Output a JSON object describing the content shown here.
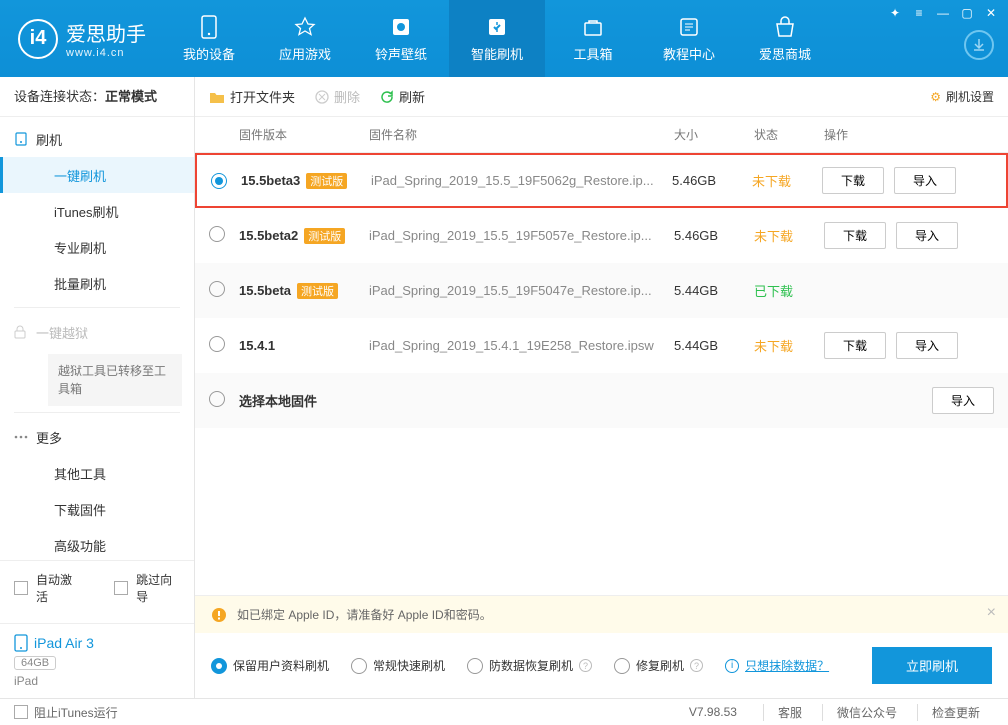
{
  "logo": {
    "title": "爱思助手",
    "sub": "www.i4.cn"
  },
  "nav": [
    {
      "label": "我的设备"
    },
    {
      "label": "应用游戏"
    },
    {
      "label": "铃声壁纸"
    },
    {
      "label": "智能刷机"
    },
    {
      "label": "工具箱"
    },
    {
      "label": "教程中心"
    },
    {
      "label": "爱思商城"
    }
  ],
  "sidebar": {
    "status_label": "设备连接状态：",
    "status_value": "正常模式",
    "items": {
      "flash": "刷机",
      "one_key": "一键刷机",
      "itunes": "iTunes刷机",
      "pro": "专业刷机",
      "batch": "批量刷机",
      "jailbreak": "一键越狱",
      "jb_note": "越狱工具已转移至工具箱",
      "more": "更多",
      "other": "其他工具",
      "download": "下载固件",
      "advanced": "高级功能"
    },
    "bottom": {
      "auto_activate": "自动激活",
      "skip_guide": "跳过向导"
    },
    "device": {
      "name": "iPad Air 3",
      "capacity": "64GB",
      "type": "iPad"
    }
  },
  "toolbar": {
    "open": "打开文件夹",
    "delete": "删除",
    "refresh": "刷新",
    "settings": "刷机设置"
  },
  "table": {
    "headers": {
      "version": "固件版本",
      "name": "固件名称",
      "size": "大小",
      "status": "状态",
      "ops": "操作"
    },
    "download_btn": "下载",
    "import_btn": "导入",
    "rows": [
      {
        "selected": true,
        "version": "15.5beta3",
        "beta": true,
        "name": "iPad_Spring_2019_15.5_19F5062g_Restore.ip...",
        "size": "5.46GB",
        "status": "未下载",
        "status_cls": "not",
        "show_dl": true,
        "hl": true
      },
      {
        "selected": false,
        "version": "15.5beta2",
        "beta": true,
        "name": "iPad_Spring_2019_15.5_19F5057e_Restore.ip...",
        "size": "5.46GB",
        "status": "未下载",
        "status_cls": "not",
        "show_dl": true
      },
      {
        "selected": false,
        "version": "15.5beta",
        "beta": true,
        "name": "iPad_Spring_2019_15.5_19F5047e_Restore.ip...",
        "size": "5.44GB",
        "status": "已下载",
        "status_cls": "done",
        "show_dl": false,
        "alt": true
      },
      {
        "selected": false,
        "version": "15.4.1",
        "beta": false,
        "name": "iPad_Spring_2019_15.4.1_19E258_Restore.ipsw",
        "size": "5.44GB",
        "status": "未下载",
        "status_cls": "not",
        "show_dl": true
      },
      {
        "selected": false,
        "version": "选择本地固件",
        "beta": false,
        "name": "",
        "size": "",
        "status": "",
        "status_cls": "",
        "show_dl": false,
        "import_only": true,
        "alt": true
      }
    ],
    "beta_tag": "测试版"
  },
  "alert": "如已绑定 Apple ID，请准备好 Apple ID和密码。",
  "options": {
    "keep": "保留用户资料刷机",
    "normal": "常规快速刷机",
    "recover": "防数据恢复刷机",
    "repair": "修复刷机",
    "erase_link": "只想抹除数据？",
    "go": "立即刷机"
  },
  "statusbar": {
    "block": "阻止iTunes运行",
    "version": "V7.98.53",
    "service": "客服",
    "wechat": "微信公众号",
    "update": "检查更新"
  }
}
